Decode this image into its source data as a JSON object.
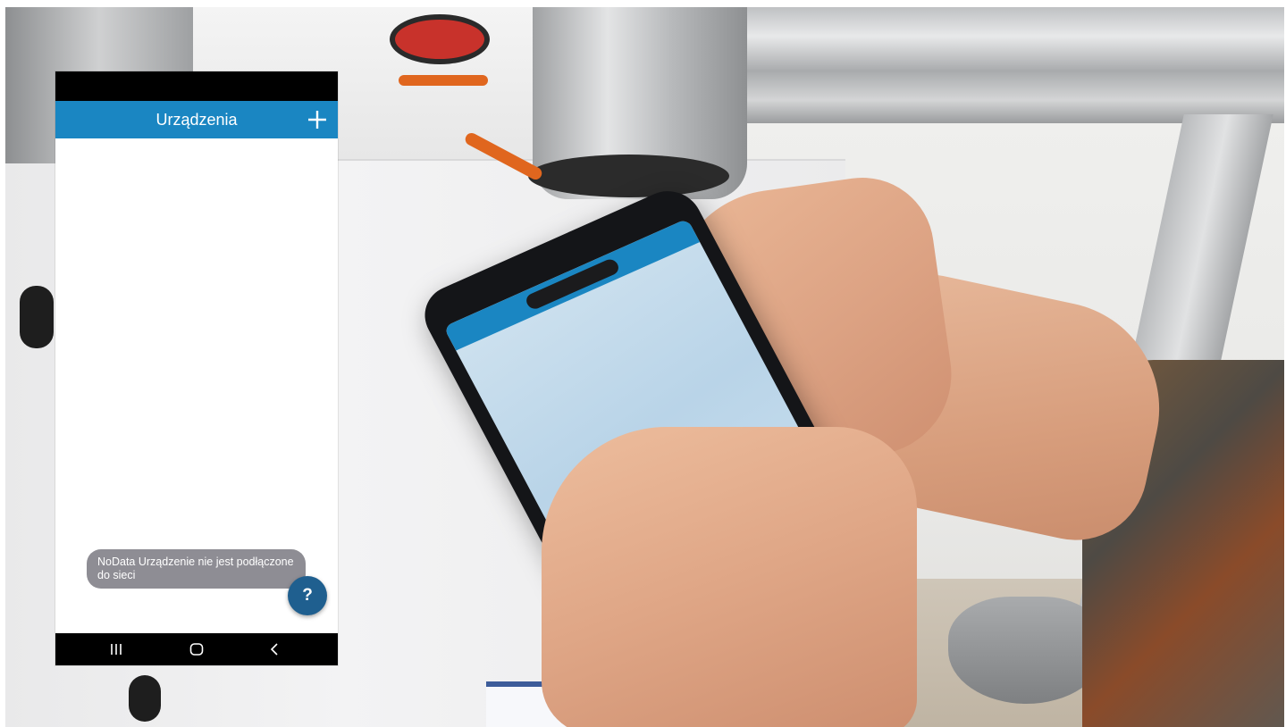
{
  "screen": {
    "title": "Urządzenia",
    "add_icon": "plus-icon",
    "toast_text": "NoData Urządzenie nie jest podłączone do sieci",
    "help_label": "?",
    "nav": {
      "recents_icon": "recents-icon",
      "home_icon": "home-icon",
      "back_icon": "back-icon"
    }
  },
  "colors": {
    "app_bar": "#1a86c2",
    "fab": "#1f5f8f",
    "toast": "#8e8d94",
    "system_bars": "#000000"
  }
}
